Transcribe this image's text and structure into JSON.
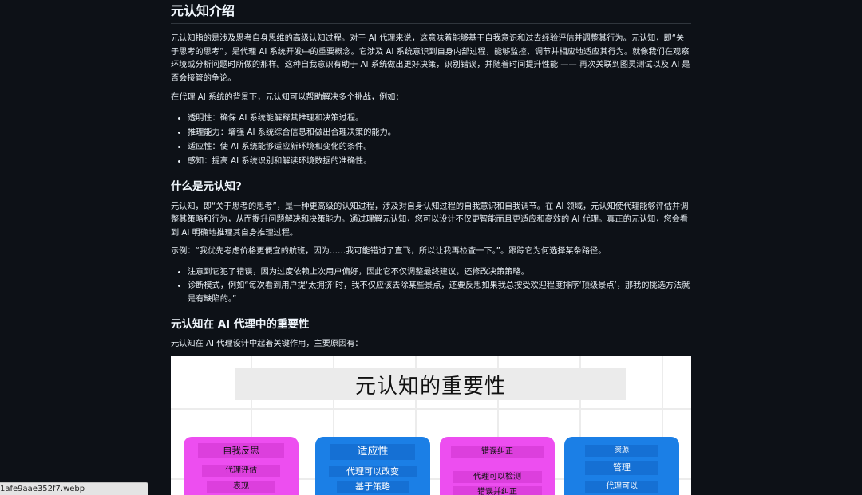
{
  "article": {
    "h_intro": "元认知介绍",
    "p_intro": "元认知指的是涉及思考自身思维的高级认知过程。对于 AI 代理来说，这意味着能够基于自我意识和过去经验评估并调整其行为。元认知，即“关于思考的思考”，是代理 AI 系统开发中的重要概念。它涉及 AI 系统意识到自身内部过程，能够监控、调节并相应地适应其行为。就像我们在观察环境或分析问题时所做的那样。这种自我意识有助于 AI 系统做出更好决策，识别错误，并随着时间提升性能 —— 再次关联到图灵测试以及 AI 是否会接管的争论。",
    "p_context": "在代理 AI 系统的背景下，元认知可以帮助解决多个挑战，例如：",
    "challenges": [
      "透明性：确保 AI 系统能解释其推理和决策过程。",
      "推理能力：增强 AI 系统综合信息和做出合理决策的能力。",
      "适应性：使 AI 系统能够适应新环境和变化的条件。",
      "感知：提高 AI 系统识别和解读环境数据的准确性。"
    ],
    "h_what": "什么是元认知?",
    "p_what": "元认知，即“关于思考的思考”，是一种更高级的认知过程，涉及对自身认知过程的自我意识和自我调节。在 AI 领域，元认知使代理能够评估并调整其策略和行为，从而提升问题解决和决策能力。通过理解元认知，您可以设计不仅更智能而且更适应和高效的 AI 代理。真正的元认知，您会看到 AI 明确地推理其自身推理过程。",
    "p_example": "示例：“我优先考虑价格更便宜的航班，因为……我可能错过了直飞，所以让我再检查一下。”。跟踪它为何选择某条路径。",
    "examples": [
      "注意到它犯了错误，因为过度依赖上次用户偏好，因此它不仅调整最终建议，还修改决策策略。",
      "诊断模式，例如“每次看到用户提‘太拥挤’时，我不仅应该去除某些景点，还要反思如果我总按受欢迎程度排序‘顶级景点’，那我的挑选方法就是有缺陷的。”"
    ],
    "h_importance": "元认知在 AI 代理中的重要性",
    "p_importance": "元认知在 AI 代理设计中起着关键作用，主要原因有："
  },
  "figure": {
    "title": "元认知的重要性",
    "cards": [
      {
        "color": "#ed4ef0",
        "title": "自我反思",
        "lines": [
          "代理评估",
          "表现"
        ]
      },
      {
        "color": "#1b7fe6",
        "title": "适应性",
        "lines": [
          "代理可以改变",
          "基于策略"
        ]
      },
      {
        "color": "#ed4ef0",
        "title": "错误纠正",
        "lines": [
          "代理可以检测",
          "错误并纠正"
        ]
      },
      {
        "color": "#1b7fe6",
        "title": "资源",
        "lines": [
          "管理",
          "代理可以"
        ]
      }
    ]
  },
  "status_bar": {
    "url": "1afe9aae352f7.webp"
  }
}
